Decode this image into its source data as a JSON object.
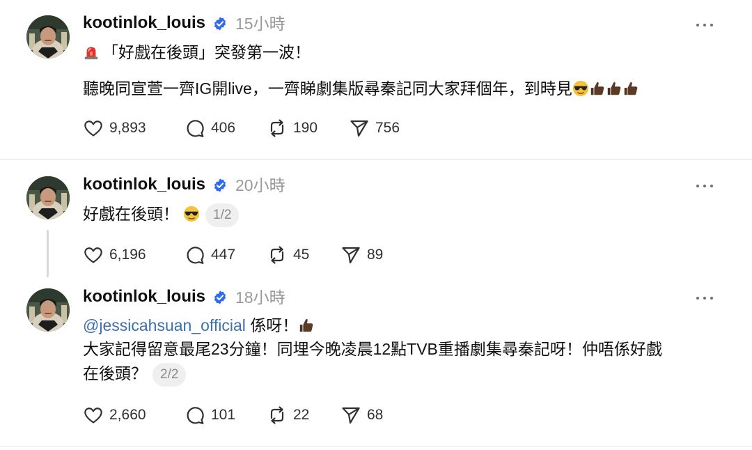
{
  "posts": [
    {
      "username": "kootinlok_louis",
      "time": "15小時",
      "line1": "「好戲在後頭」突發第一波！",
      "line2": "聽晚同宣萱一齊IG開live，一齊睇劇集版尋秦記同大家拜個年，到時見",
      "likes": "9,893",
      "comments": "406",
      "reposts": "190",
      "shares": "756"
    },
    {
      "username": "kootinlok_louis",
      "time": "20小時",
      "line1": "好戲在後頭！",
      "page": "1/2",
      "likes": "6,196",
      "comments": "447",
      "reposts": "45",
      "shares": "89"
    },
    {
      "username": "kootinlok_louis",
      "time": "18小時",
      "mention": "@jessicahsuan_official",
      "line1": "係呀！",
      "line2": "大家記得留意最尾23分鐘！同埋今晚凌晨12點TVB重播劇集尋秦記呀！仲唔係好戲",
      "line3": "在後頭？",
      "page": "2/2",
      "likes": "2,660",
      "comments": "101",
      "reposts": "22",
      "shares": "68"
    }
  ],
  "icons": {
    "verified": "verified-badge-icon",
    "more": "more-options-icon",
    "like": "heart-icon",
    "comment": "comment-bubble-icon",
    "repost": "repost-icon",
    "share": "send-icon",
    "siren": "siren-emoji",
    "sunglasses": "sunglasses-emoji",
    "thumbs": "thumbs-up-emoji"
  },
  "colors": {
    "verified": "#2f6bed",
    "mention": "#3b6fae",
    "timestamp": "#999999"
  }
}
